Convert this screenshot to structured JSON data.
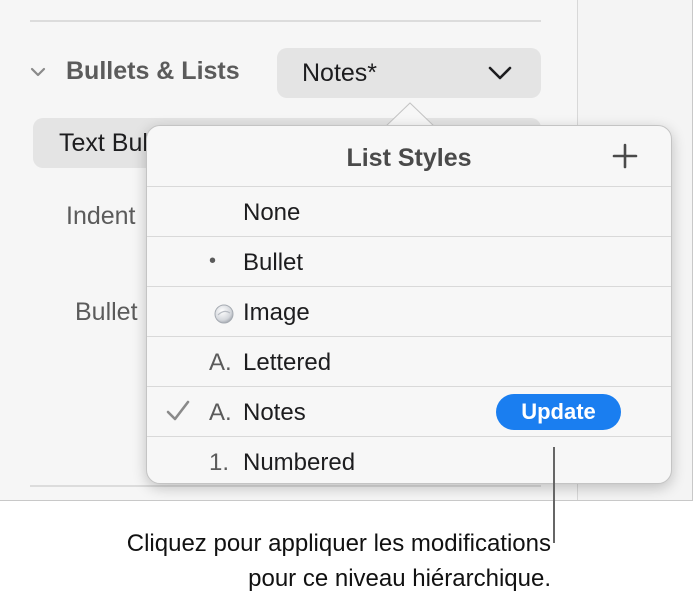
{
  "sidebar": {
    "section_title": "Bullets & Lists",
    "list_style_value": "Notes*",
    "bullet_type_value": "Text Bul",
    "indent_label": "Indent",
    "bullet_label": "Bullet"
  },
  "popover": {
    "title": "List Styles",
    "add_icon": "plus-icon",
    "items": [
      {
        "marker": "",
        "label": "None",
        "checked": false
      },
      {
        "marker": "•",
        "label": "Bullet",
        "checked": false
      },
      {
        "marker": "image-bullet-icon",
        "label": "Image",
        "checked": false
      },
      {
        "marker": "A.",
        "label": "Lettered",
        "checked": false
      },
      {
        "marker": "A.",
        "label": "Notes",
        "checked": true,
        "action": "Update"
      },
      {
        "marker": "1.",
        "label": "Numbered",
        "checked": false
      }
    ]
  },
  "callout": {
    "line1": "Cliquez pour appliquer les modifications",
    "line2": "pour ce niveau hiérarchique."
  },
  "colors": {
    "accent": "#1a7ef0",
    "panel_bg": "#f6f6f6",
    "popover_bg": "#f7f7f7",
    "control_bg": "#e4e4e4"
  }
}
